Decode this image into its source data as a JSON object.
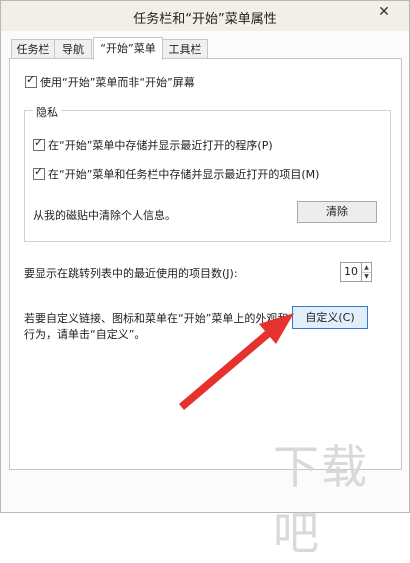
{
  "window": {
    "title": "任务栏和“开始”菜单属性",
    "close_label": "✕"
  },
  "tabs": [
    {
      "label": "任务栏"
    },
    {
      "label": "导航"
    },
    {
      "label": "“开始”菜单"
    },
    {
      "label": "工具栏"
    }
  ],
  "start_menu": {
    "use_start_menu": {
      "label": "使用“开始”菜单而非“开始”屏幕",
      "checked": true
    },
    "privacy": {
      "legend": "隐私",
      "store_recent_programs": {
        "label": "在“开始”菜单中存储并显示最近打开的程序(P)",
        "checked": true
      },
      "store_recent_items": {
        "label": "在“开始”菜单和任务栏中存储并显示最近打开的项目(M)",
        "checked": true
      },
      "clear_text": "从我的磁贴中清除个人信息。",
      "clear_button": "清除"
    },
    "jump_list": {
      "label": "要显示在跳转列表中的最近使用的项目数(J):",
      "value": "10"
    },
    "customize": {
      "line1": "若要自定义链接、图标和菜单在“开始”菜单上的外观和",
      "line2": "行为，请单击“自定义”。",
      "button": "自定义(C)"
    }
  },
  "watermark": "下载吧",
  "colors": {
    "accent_blue": "#2d7bd2",
    "arrow_red": "#e5322d"
  }
}
